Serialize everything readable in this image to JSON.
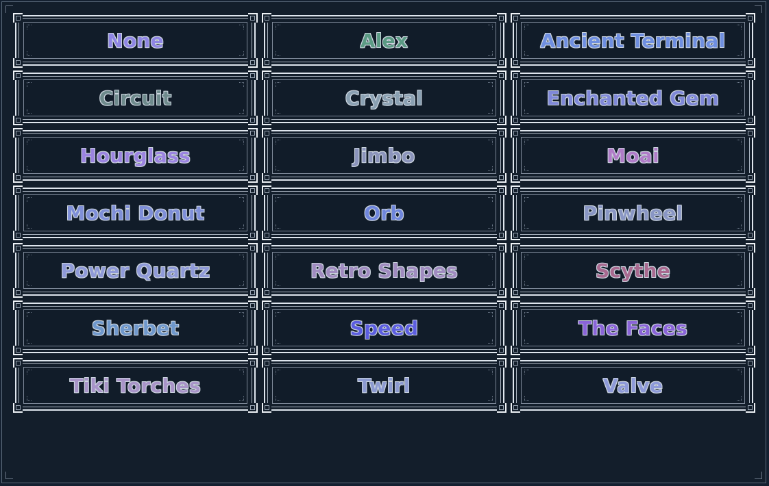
{
  "options": [
    {
      "label": "None",
      "color": "#8f86e4"
    },
    {
      "label": "Alex",
      "color": "#5b9a84"
    },
    {
      "label": "Ancient Terminal",
      "color": "#6f8fe0"
    },
    {
      "label": "Circuit",
      "color": "#6e8a8c"
    },
    {
      "label": "Crystal",
      "color": "#8aa0b2"
    },
    {
      "label": "Enchanted Gem",
      "color": "#7f88d8"
    },
    {
      "label": "Hourglass",
      "color": "#9b84e0"
    },
    {
      "label": "Jimbo",
      "color": "#8b94bb"
    },
    {
      "label": "Moai",
      "color": "#b07cc8"
    },
    {
      "label": "Mochi Donut",
      "color": "#7f8fd8"
    },
    {
      "label": "Orb",
      "color": "#6f86dc"
    },
    {
      "label": "Pinwheel",
      "color": "#8996c4"
    },
    {
      "label": "Power Quartz",
      "color": "#8f9ad8"
    },
    {
      "label": "Retro Shapes",
      "color": "#a08cc0"
    },
    {
      "label": "Scythe",
      "color": "#a86a90"
    },
    {
      "label": "Sherbet",
      "color": "#6f98cc"
    },
    {
      "label": "Speed",
      "color": "#5c5ee0"
    },
    {
      "label": "The Faces",
      "color": "#8a64d8"
    },
    {
      "label": "Tiki Torches",
      "color": "#a894c8"
    },
    {
      "label": "Twirl",
      "color": "#8c9ad0"
    },
    {
      "label": "Valve",
      "color": "#8e9ad8"
    }
  ]
}
